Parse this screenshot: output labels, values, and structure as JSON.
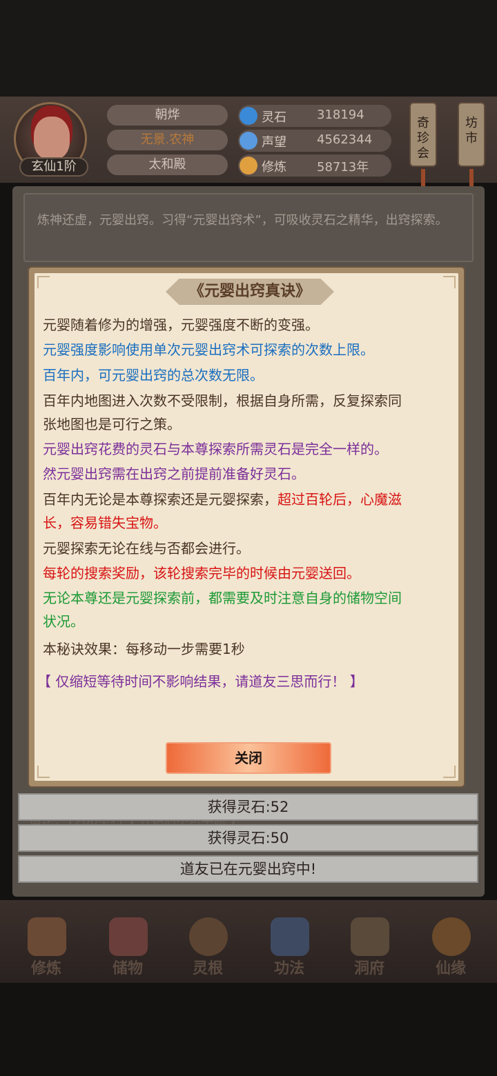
{
  "player": {
    "rank": "玄仙1阶"
  },
  "info_pills": {
    "name": "朝烨",
    "title": "无景.农神",
    "hall": "太和殿"
  },
  "resources": [
    {
      "label": "灵石",
      "value": "318194",
      "icon": "spirit-stone-icon",
      "color": "#3a8ad8"
    },
    {
      "label": "声望",
      "value": "4562344",
      "icon": "reputation-icon",
      "color": "#5a9ae0"
    },
    {
      "label": "修炼",
      "value": "58713年",
      "icon": "cultivation-icon",
      "color": "#e0a040"
    }
  ],
  "side_buttons": {
    "treasure": "奇\n珍\n会",
    "market": "坊\n市"
  },
  "description": "炼神还虚，元婴出窍。习得“元婴出窍术”，可吸收灵石之精华，出窍探索。",
  "modal": {
    "title": "《元婴出窍真诀》",
    "rules": [
      {
        "text": "元婴随着修为的增强，元婴强度不断的变强。"
      },
      {
        "text": "元婴强度影响使用单次元婴出窍术可探索的次数上限。"
      },
      {
        "text": "百年内，可元婴出窍的总次数无限。"
      },
      {
        "line1": "百年内地图进入次数不受限制，根据自身所需，反复探索同",
        "line2": "张地图也是可行之策。"
      },
      {
        "text": "元婴出窍花费的灵石与本尊探索所需灵石是完全一样的。"
      },
      {
        "text": "然元婴出窍需在出窍之前提前准备好灵石。"
      },
      {
        "line1a": "百年内无论是本尊探索还是元婴探索，",
        "line1b": "超过百轮后，心魔滋",
        "line2": "长，容易错失宝物。"
      },
      {
        "text": "元婴探索无论在线与否都会进行。"
      },
      {
        "text": "每轮的搜索奖励，该轮搜索完毕的时候由元婴送回。"
      },
      {
        "line1": "无论本尊还是元婴探索前，都需要及时注意自身的储物空间",
        "line2": "状况。"
      },
      {
        "text": "本秘诀效果：每移动一步需要1秒"
      }
    ],
    "notice": "【 仅缩短等待时间不影响结果，请道友三思而行！ 】",
    "close_label": "关闭"
  },
  "toasts": [
    "获得灵石:52",
    "获得灵石:50",
    "道友已在元婴出窍中!"
  ],
  "nav": [
    {
      "label": "修炼",
      "icon": "cultivate-icon"
    },
    {
      "label": "储物",
      "icon": "storage-bag-icon"
    },
    {
      "label": "灵根",
      "icon": "spirit-root-icon"
    },
    {
      "label": "功法",
      "icon": "technique-book-icon"
    },
    {
      "label": "洞府",
      "icon": "cave-dwelling-icon"
    },
    {
      "label": "仙缘",
      "icon": "fortune-gourd-icon"
    }
  ]
}
